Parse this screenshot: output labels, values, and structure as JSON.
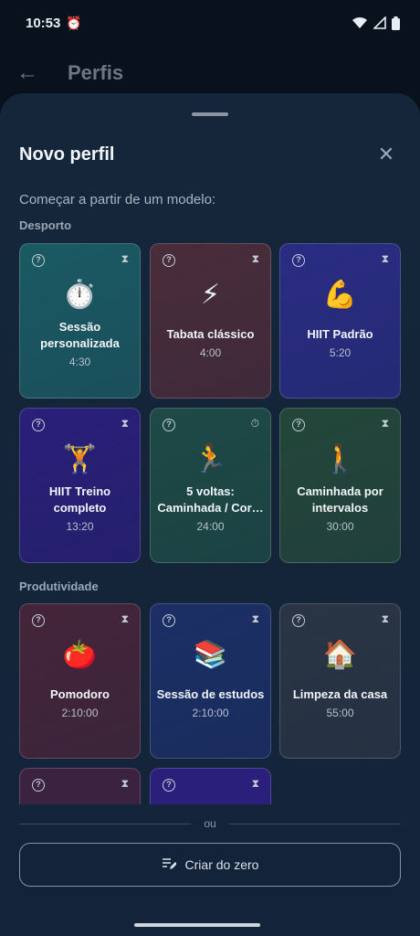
{
  "status_bar": {
    "time": "10:53",
    "alarm_icon": "alarm-icon",
    "wifi_icon": "wifi-icon",
    "signal_icon": "signal-icon",
    "battery_icon": "battery-icon"
  },
  "appbar": {
    "back_icon": "arrow-back-icon",
    "title": "Perfis"
  },
  "sheet": {
    "title": "Novo perfil",
    "close_icon": "close-icon",
    "subtitle": "Começar a partir de um modelo:",
    "sections": [
      {
        "label": "Desporto",
        "cards": [
          {
            "emoji": "⏱️",
            "name": "Sessão\npersonalizada",
            "duration": "4:30",
            "color": "#1b5a63",
            "timer_icon": "hourglass-icon"
          },
          {
            "emoji": "⚡",
            "name": "Tabata clássico",
            "duration": "4:00",
            "color": "#4a2c3a",
            "timer_icon": "hourglass-icon"
          },
          {
            "emoji": "💪",
            "name": "HIIT Padrão",
            "duration": "5:20",
            "color": "#2a2c83",
            "timer_icon": "hourglass-icon"
          },
          {
            "emoji": "🏋️",
            "name": "HIIT Treino\ncompleto",
            "duration": "13:20",
            "color": "#2a1f7a",
            "timer_icon": "hourglass-icon"
          },
          {
            "emoji": "🏃",
            "name": "5 voltas:\nCaminhada / Cor…",
            "duration": "24:00",
            "color": "#1e4a46",
            "timer_icon": "stopwatch-icon"
          },
          {
            "emoji": "🚶",
            "name": "Caminhada por\nintervalos",
            "duration": "30:00",
            "color": "#24473b",
            "timer_icon": "hourglass-icon"
          }
        ]
      },
      {
        "label": "Produtividade",
        "cards": [
          {
            "emoji": "🍅",
            "name": "Pomodoro",
            "duration": "2:10:00",
            "color": "#45253a",
            "timer_icon": "hourglass-icon"
          },
          {
            "emoji": "📚",
            "name": "Sessão de estudos",
            "duration": "2:10:00",
            "color": "#1c2f66",
            "timer_icon": "hourglass-icon"
          },
          {
            "emoji": "🏠",
            "name": "Limpeza da casa",
            "duration": "55:00",
            "color": "#2a3545",
            "timer_icon": "hourglass-icon"
          }
        ]
      }
    ],
    "partial_cards": [
      {
        "color": "#3a2240"
      },
      {
        "color": "#2a1f7a"
      }
    ],
    "divider_text": "ou",
    "create_button": {
      "icon": "edit-list-icon",
      "label": "Criar do zero"
    }
  }
}
